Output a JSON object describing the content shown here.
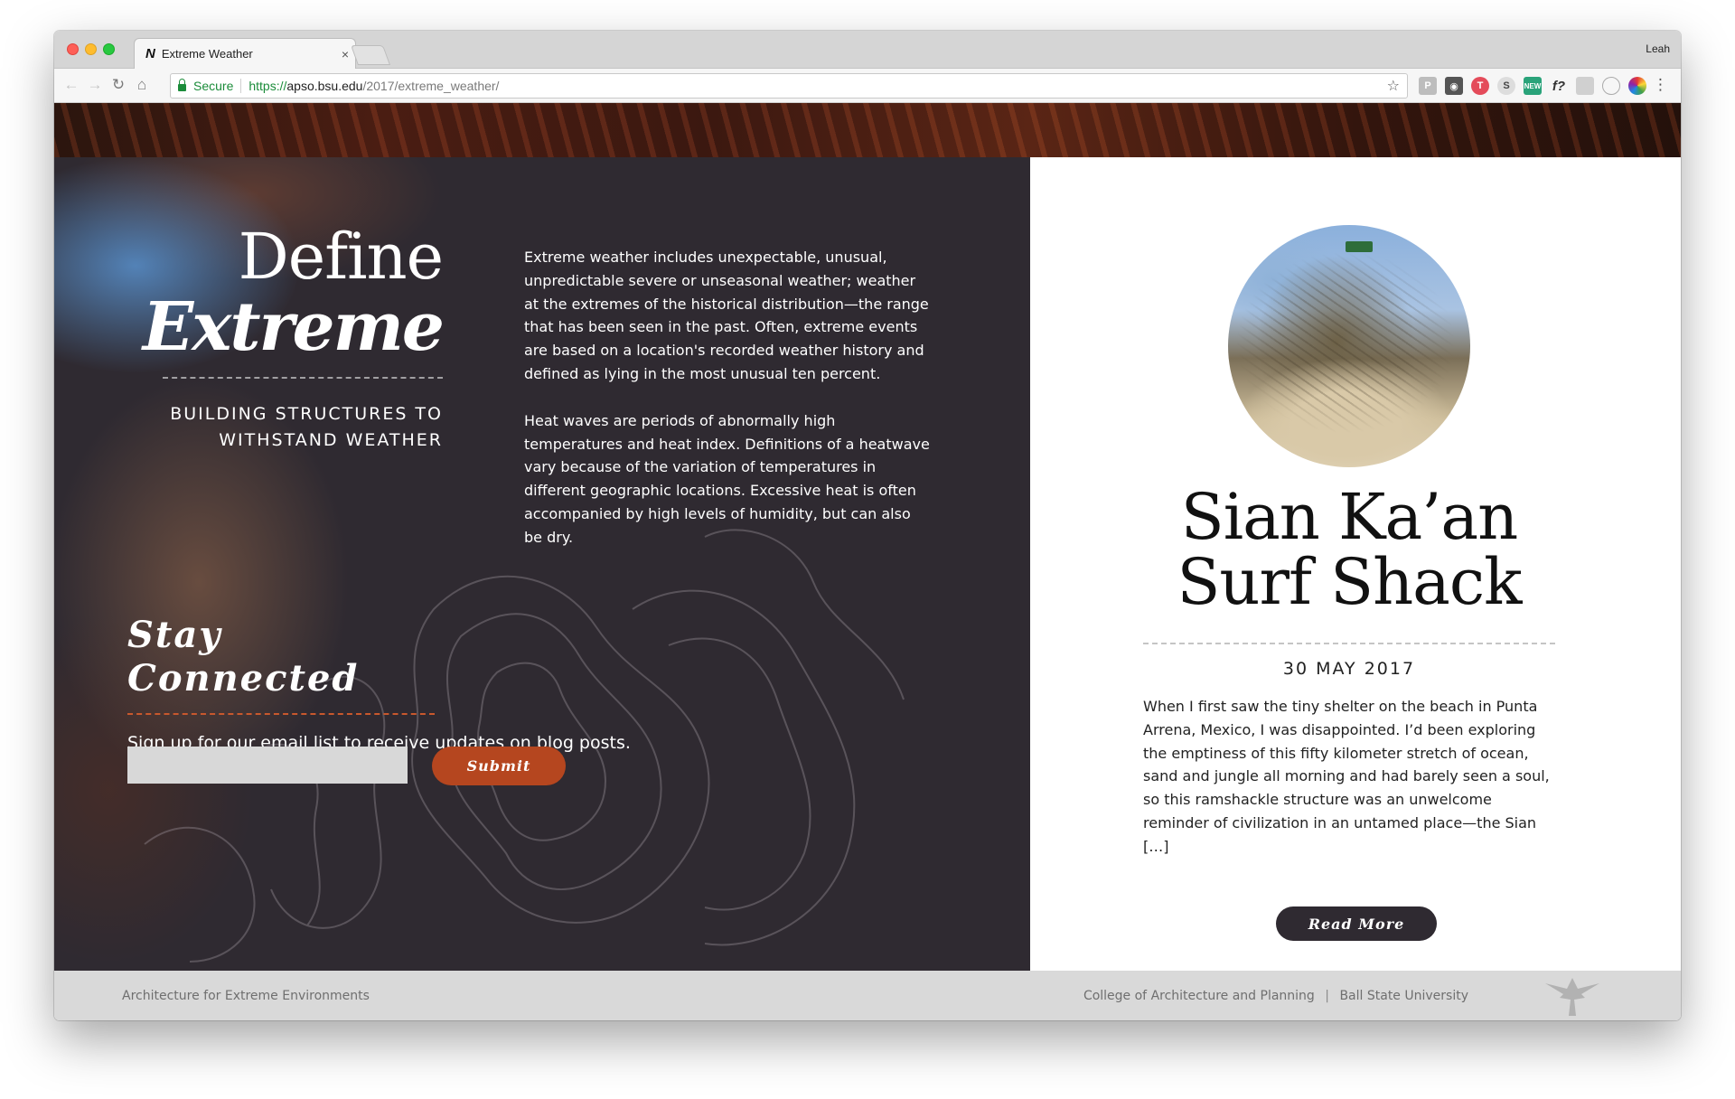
{
  "browser": {
    "tab_title": "Extreme Weather",
    "tab_favicon": "N",
    "tab_close": "×",
    "profile_name": "Leah",
    "secure_label": "Secure",
    "url_scheme": "https://",
    "url_host": "apso.bsu.edu",
    "url_path": "/2017/extreme_weather/",
    "colors": {
      "secure_green": "#1b8c3a",
      "chrome_gray": "#d5d5d5"
    },
    "extensions": [
      "pocket-icon",
      "ghostery-icon",
      "todoist-icon",
      "s-extension-icon",
      "new-extension-icon",
      "formula-icon",
      "reader-icon",
      "circle-icon",
      "color-wheel-icon"
    ]
  },
  "hero": {
    "define_title": "Define",
    "extreme_title": "Extreme",
    "subtitle": "BUILDING STRUCTURES TO WITHSTAND WEATHER"
  },
  "intro": {
    "paragraph_1": "Extreme weather includes unexpectable, unusual, unpredictable severe or unseasonal weather; weather at the extremes of the historical distribution—the range that has been seen in the past. Often, extreme events are based on a location's recorded weather history and defined as lying in the most unusual ten percent.",
    "paragraph_2": "Heat waves are periods of abnormally high temperatures and heat index. Definitions of a heatwave vary because of the variation of temperatures in different geographic locations. Excessive heat is often accompanied by high levels of humidity, but can also be dry."
  },
  "newsletter": {
    "title": "Stay Connected",
    "description": "Sign up for our email list to receive updates on blog posts.",
    "email_placeholder": "",
    "submit_label": "Submit"
  },
  "post": {
    "title": "Sian Ka’an Surf Shack",
    "date": "30 MAY 2017",
    "excerpt": "When I first saw the tiny shelter on the beach in Punta Arrena, Mexico, I was disappointed. I’d been exploring the emptiness of this fifty kilometer stretch of ocean, sand and jungle all morning and had barely seen a soul, so this ramshackle structure was an unwelcome reminder of civilization in an untamed place—the Sian […]",
    "read_more_label": "Read More"
  },
  "footer": {
    "left_text": "Architecture for Extreme Environments",
    "college": "College of Architecture and Planning",
    "separator": "|",
    "university": "Ball State University"
  },
  "colors": {
    "dark_panel": "#2f2a31",
    "accent_orange": "#b5461f",
    "footer_gray": "#d9d9d9"
  }
}
